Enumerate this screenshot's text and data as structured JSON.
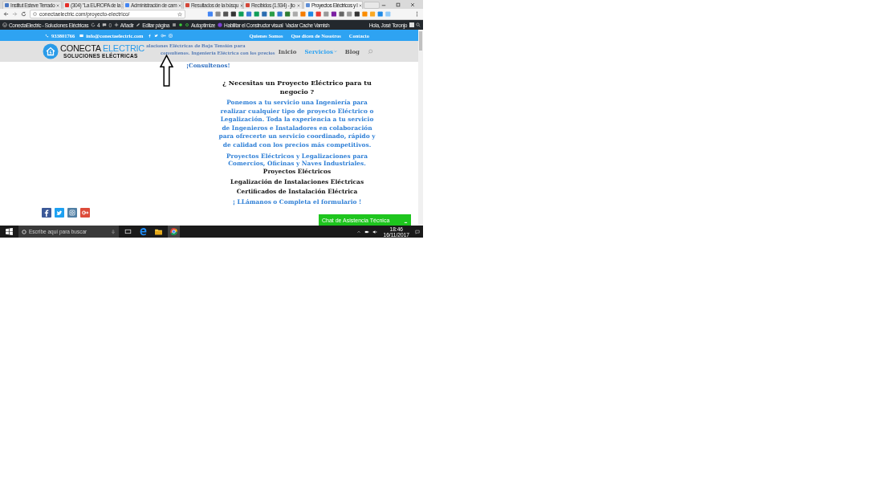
{
  "browser": {
    "tabs": [
      {
        "title": "Institut Esteve Terrado",
        "selected": false,
        "color": "#4a78c2"
      },
      {
        "title": "(304) \"La EUROPA de la",
        "selected": false,
        "color": "#e52d27"
      },
      {
        "title": "Administración de cam",
        "selected": false,
        "color": "#4285f4"
      },
      {
        "title": "Resultados de la búsqu",
        "selected": false,
        "color": "#d44638"
      },
      {
        "title": "Recibidos (1.934) - jto",
        "selected": false,
        "color": "#d44638"
      },
      {
        "title": "Proyectos Eléctricos y l",
        "selected": true,
        "color": "#5f8fd6"
      }
    ],
    "address": "conectaelectric.com/proyecto-electrico/"
  },
  "admin_bar": {
    "site": "ConectaElectric - Soluciones Eléctricas",
    "updates": "4",
    "comments": "0",
    "add": "Añadir",
    "edit": "Editar página",
    "autoptimize": "Autoptimize",
    "builder": "Habilitar el Constructor visual",
    "cache": "Vaciar Cache Varnish",
    "greeting": "Hola, José Toronjo"
  },
  "top_bar": {
    "phone": "933801766",
    "email": "info@conectaelectric.com",
    "links": [
      "Quienes Somos",
      "Que dicen de Nosotros",
      "Contacto"
    ]
  },
  "header": {
    "logo_main": "CONECTA",
    "logo_accent": "ELECTRIC",
    "logo_sub": "SOLUCIONES ELÉCTRICAS",
    "nav": [
      {
        "label": "Inicio",
        "selected": false,
        "dropdown": false
      },
      {
        "label": "Servicios",
        "selected": true,
        "dropdown": true
      },
      {
        "label": "Blog",
        "selected": false,
        "dropdown": false
      }
    ]
  },
  "content": {
    "intro": [
      "alaciones Eléctricas de Baja Tensión para",
      "consultenos. Ingeniería Eléctrica con los precios"
    ],
    "consult": "¡Consultenos!",
    "heading": "¿ Necesitas un Proyecto Eléctrico para tu negocio ?",
    "paragraph": "Ponemos a tu servicio una Ingeniería para realizar cualquier tipo de proyecto Eléctrico o Legalización.  Toda la experiencia a tu servicio de Ingenieros e Instaladores en colaboración para ofrecerte un servicio coordinado, rápido y de calidad con los precios más competitivos.",
    "scope": "Proyectos Eléctricos y Legalizaciones para Comercios, Oficinas y Naves Industriales.",
    "services": [
      "Proyectos Eléctricos",
      "Legalización de Instalaciones Eléctricas",
      "Certificados de Instalación Eléctrica"
    ],
    "cta": "¡ LLámanos o Completa el formulario !"
  },
  "chat": {
    "title": "Chat de Asistencia Técnica"
  },
  "taskbar": {
    "search_placeholder": "Escribe aquí para buscar",
    "time": "18:46",
    "date": "16/11/2017"
  }
}
